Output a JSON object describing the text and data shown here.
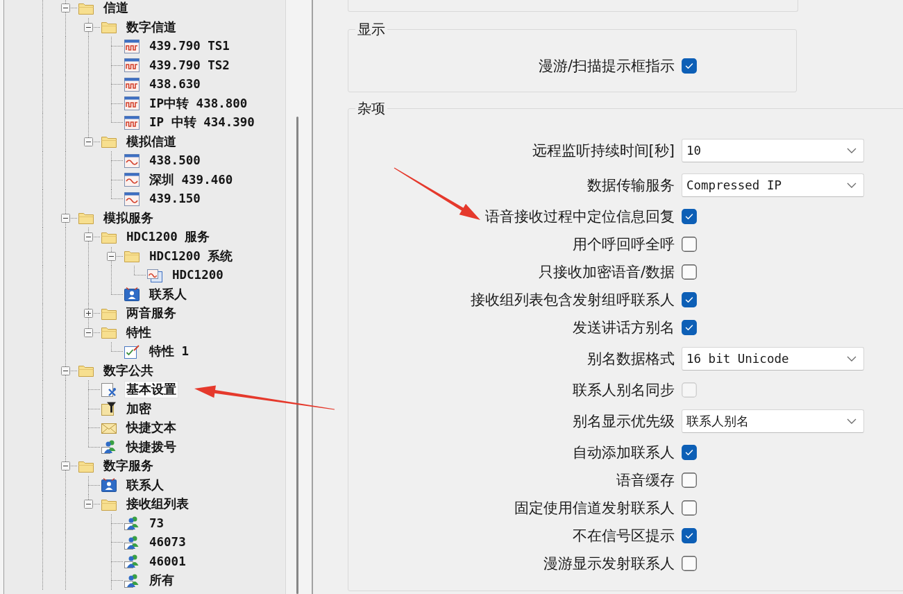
{
  "tree": {
    "items": [
      {
        "kind": "folder",
        "label": "信道",
        "expanded": true,
        "selected": false,
        "children": [
          {
            "kind": "folder",
            "label": "数字信道",
            "expanded": true,
            "selected": false,
            "children": [
              {
                "kind": "digital",
                "label": "439.790 TS1",
                "selected": false
              },
              {
                "kind": "digital",
                "label": "439.790 TS2",
                "selected": false
              },
              {
                "kind": "digital",
                "label": "438.630",
                "selected": false
              },
              {
                "kind": "digital",
                "label": "IP中转 438.800",
                "selected": false
              },
              {
                "kind": "digital",
                "label": "IP 中转 434.390",
                "selected": false
              }
            ]
          },
          {
            "kind": "folder",
            "label": "模拟信道",
            "expanded": true,
            "selected": false,
            "children": [
              {
                "kind": "analog",
                "label": "438.500",
                "selected": false
              },
              {
                "kind": "analog",
                "label": "深圳 439.460",
                "selected": false
              },
              {
                "kind": "analog",
                "label": "439.150",
                "selected": false
              }
            ]
          }
        ]
      },
      {
        "kind": "folder",
        "label": "模拟服务",
        "expanded": true,
        "selected": false,
        "children": [
          {
            "kind": "folder",
            "label": "HDC1200 服务",
            "expanded": true,
            "selected": false,
            "children": [
              {
                "kind": "folder",
                "label": "HDC1200 系统",
                "expanded": true,
                "selected": false,
                "children": [
                  {
                    "kind": "hdc",
                    "label": "HDC1200",
                    "selected": false
                  }
                ]
              },
              {
                "kind": "contacts",
                "label": "联系人",
                "selected": false
              }
            ]
          },
          {
            "kind": "folder",
            "label": "两音服务",
            "expanded": false,
            "selected": false
          },
          {
            "kind": "folder",
            "label": "特性",
            "expanded": true,
            "selected": false,
            "children": [
              {
                "kind": "profile",
                "label": "特性 1",
                "selected": false
              }
            ]
          }
        ]
      },
      {
        "kind": "folder",
        "label": "数字公共",
        "expanded": true,
        "selected": false,
        "children": [
          {
            "kind": "settings",
            "label": "基本设置",
            "selected": true
          },
          {
            "kind": "encryption",
            "label": "加密",
            "selected": false
          },
          {
            "kind": "message",
            "label": "快捷文本",
            "selected": false
          },
          {
            "kind": "group",
            "label": "快捷拨号",
            "selected": false
          }
        ]
      },
      {
        "kind": "folder",
        "label": "数字服务",
        "expanded": true,
        "selected": false,
        "children": [
          {
            "kind": "contacts",
            "label": "联系人",
            "selected": false
          },
          {
            "kind": "folder",
            "label": "接收组列表",
            "expanded": true,
            "selected": false,
            "children": [
              {
                "kind": "group",
                "label": "73",
                "selected": false
              },
              {
                "kind": "group",
                "label": "46073",
                "selected": false
              },
              {
                "kind": "group",
                "label": "46001",
                "selected": false
              },
              {
                "kind": "group",
                "label": "所有",
                "selected": false
              }
            ]
          }
        ]
      }
    ]
  },
  "settings": {
    "groups": [
      {
        "title": "显示",
        "rows": [
          {
            "kind": "checkbox",
            "label": "漫游/扫描提示框指示",
            "checked": true,
            "disabled": false
          }
        ]
      },
      {
        "title": "杂项",
        "rows": [
          {
            "kind": "dropdown",
            "label": "远程监听持续时间[秒]",
            "value": "10",
            "disabled": false
          },
          {
            "kind": "dropdown",
            "label": "数据传输服务",
            "value": "Compressed IP",
            "disabled": false
          },
          {
            "kind": "checkbox",
            "label": "语音接收过程中定位信息回复",
            "checked": true,
            "disabled": false
          },
          {
            "kind": "checkbox",
            "label": "用个呼回呼全呼",
            "checked": false,
            "disabled": false
          },
          {
            "kind": "checkbox",
            "label": "只接收加密语音/数据",
            "checked": false,
            "disabled": false
          },
          {
            "kind": "checkbox",
            "label": "接收组列表包含发射组呼联系人",
            "checked": true,
            "disabled": false
          },
          {
            "kind": "checkbox",
            "label": "发送讲话方别名",
            "checked": true,
            "disabled": false
          },
          {
            "kind": "dropdown",
            "label": "别名数据格式",
            "value": "16 bit Unicode",
            "disabled": false
          },
          {
            "kind": "checkbox",
            "label": "联系人别名同步",
            "checked": false,
            "disabled": true
          },
          {
            "kind": "dropdown",
            "label": "别名显示优先级",
            "value": "联系人别名",
            "disabled": false
          },
          {
            "kind": "checkbox",
            "label": "自动添加联系人",
            "checked": true,
            "disabled": false
          },
          {
            "kind": "checkbox",
            "label": "语音缓存",
            "checked": false,
            "disabled": false
          },
          {
            "kind": "checkbox",
            "label": "固定使用信道发射联系人",
            "checked": false,
            "disabled": false
          },
          {
            "kind": "checkbox",
            "label": "不在信号区提示",
            "checked": true,
            "disabled": false
          },
          {
            "kind": "checkbox",
            "label": "漫游显示发射联系人",
            "checked": false,
            "disabled": false
          }
        ]
      }
    ]
  }
}
